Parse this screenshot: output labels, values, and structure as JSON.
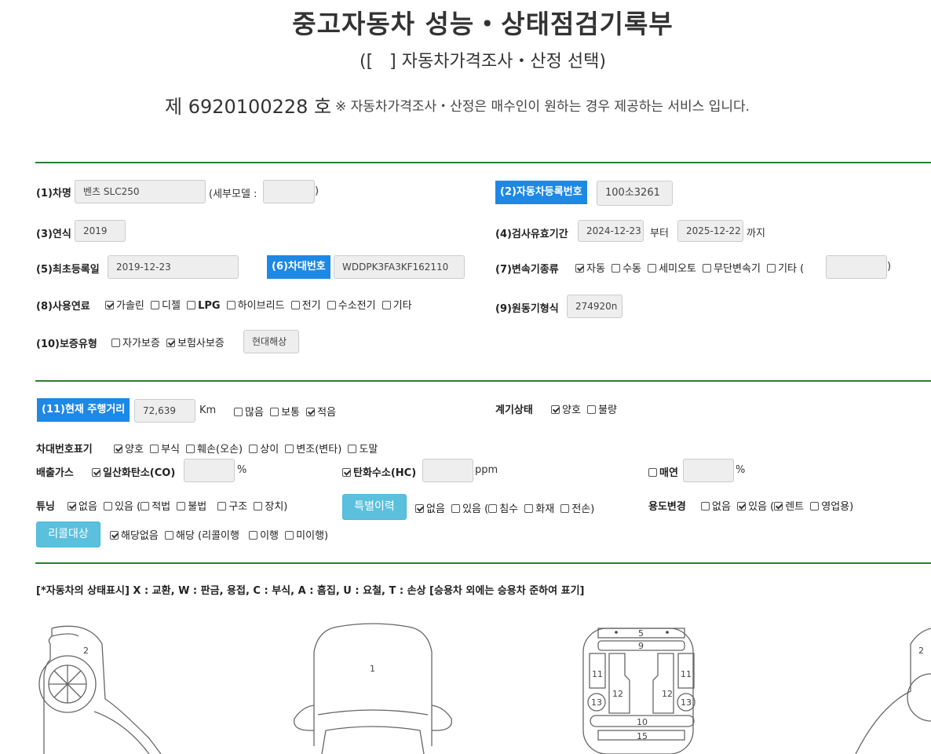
{
  "header": {
    "title": "중고자동차 성능・상태점검기록부",
    "subtitle": "([   ] 자동차가격조사・산정 선택)",
    "doc_number": "제 6920100228 호",
    "note": "※ 자동차가격조사・산정은 매수인이 원하는 경우 제공하는 서비스 입니다."
  },
  "form": {
    "car_name": {
      "label": "(1)차명",
      "value": "벤츠 SLC250",
      "detail_prefix": "(세부모델 :",
      "detail_value": "",
      "detail_suffix": ")"
    },
    "reg_no": {
      "label": "(2)자동차등록번호",
      "value": "100소3261"
    },
    "year": {
      "label": "(3)연식",
      "value": "2019"
    },
    "inspection_period": {
      "label": "(4)검사유효기간",
      "from": "2024-12-23",
      "from_suffix": "부터",
      "to": "2025-12-22",
      "to_suffix": "까지"
    },
    "first_reg": {
      "label": "(5)최초등록일",
      "value": "2019-12-23"
    },
    "vin": {
      "label": "(6)차대번호",
      "value": "WDDPK3FA3KF162110"
    },
    "transmission": {
      "label": "(7)변속기종류",
      "options": [
        {
          "text": "자동",
          "checked": true
        },
        {
          "text": "수동",
          "checked": false
        },
        {
          "text": "세미오토",
          "checked": false
        },
        {
          "text": "무단변속기",
          "checked": false
        },
        {
          "text": "기타 (",
          "checked": false
        }
      ],
      "other_value": "",
      "suffix": ")"
    },
    "fuel": {
      "label": "(8)사용연료",
      "options": [
        {
          "text": "가솔린",
          "checked": true
        },
        {
          "text": "디젤",
          "checked": false
        },
        {
          "text": "LPG",
          "checked": false
        },
        {
          "text": "하이브리드",
          "checked": false
        },
        {
          "text": "전기",
          "checked": false
        },
        {
          "text": "수소전기",
          "checked": false
        },
        {
          "text": "기타",
          "checked": false
        }
      ]
    },
    "engine": {
      "label": "(9)원동기형식",
      "value": "274920n"
    },
    "warranty": {
      "label": "(10)보증유형",
      "options": [
        {
          "text": "자가보증",
          "checked": false
        },
        {
          "text": "보험사보증",
          "checked": true
        }
      ],
      "value": "현대해상"
    },
    "mileage": {
      "label": "(11)현재 주행거리",
      "value": "72,639",
      "unit": "Km",
      "options": [
        {
          "text": "많음",
          "checked": false
        },
        {
          "text": "보통",
          "checked": false
        },
        {
          "text": "적음",
          "checked": true
        }
      ]
    },
    "gauge": {
      "label": "계기상태",
      "options": [
        {
          "text": "양호",
          "checked": true
        },
        {
          "text": "불량",
          "checked": false
        }
      ]
    },
    "vin_mark": {
      "label": "차대번호표기",
      "options": [
        {
          "text": "양호",
          "checked": true
        },
        {
          "text": "부식",
          "checked": false
        },
        {
          "text": "훼손(오손)",
          "checked": false
        },
        {
          "text": "상이",
          "checked": false
        },
        {
          "text": "변조(변타)",
          "checked": false
        },
        {
          "text": "도말",
          "checked": false
        }
      ]
    },
    "emission": {
      "label": "배출가스",
      "co": {
        "text": "일산화탄소(CO)",
        "checked": true,
        "value": "",
        "unit": "%"
      },
      "hc": {
        "text": "탄화수소(HC)",
        "checked": true,
        "value": "",
        "unit": "ppm"
      },
      "smoke": {
        "text": "매연",
        "checked": false,
        "value": "",
        "unit": "%"
      }
    },
    "tuning": {
      "label": "튜닝",
      "none": {
        "text": "없음",
        "checked": true
      },
      "yes": {
        "text": "있음 (",
        "checked": false
      },
      "legal": {
        "text": "적법",
        "checked": false
      },
      "illegal": {
        "text": "불법",
        "checked": false
      },
      "structure": {
        "text": "구조",
        "checked": false
      },
      "device": {
        "text": "장치)",
        "checked": false
      }
    },
    "special_history": {
      "button": "특별이력",
      "none": {
        "text": "없음",
        "checked": true
      },
      "yes": {
        "text": "있음 (",
        "checked": false
      },
      "flood": {
        "text": "침수",
        "checked": false
      },
      "fire": {
        "text": "화재",
        "checked": false
      },
      "total": {
        "text": "전손)",
        "checked": false
      }
    },
    "usage_change": {
      "label": "용도변경",
      "none": {
        "text": "없음",
        "checked": false
      },
      "yes": {
        "text": "있음 (",
        "checked": true
      },
      "rent": {
        "text": "렌트",
        "checked": true
      },
      "business": {
        "text": "영업용)",
        "checked": false
      }
    },
    "recall": {
      "button": "리콜대상",
      "none": {
        "text": "해당없음",
        "checked": true
      },
      "yes": {
        "text": "해당 (리콜이행",
        "checked": false
      },
      "done": {
        "text": "이행",
        "checked": false
      },
      "notdone": {
        "text": "미이행)",
        "checked": false
      }
    }
  },
  "legend": "[*자동차의 상태표시] X : 교환, W : 판금, 용접, C : 부식, A : 흠집, U : 요철, T : 손상 [승용차 외에는 승용차 준하여 표기]",
  "diagram": {
    "labels": [
      "2",
      "1",
      "5",
      "9",
      "11",
      "11",
      "12",
      "12",
      "13",
      "13",
      "10",
      "15",
      "2"
    ]
  }
}
